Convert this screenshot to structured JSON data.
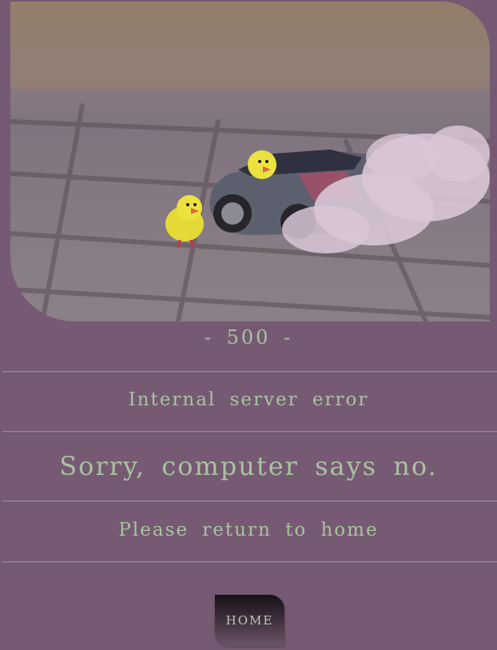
{
  "error": {
    "code_line": "- 500 -",
    "title": "Internal server error",
    "message": "Sorry, computer says no.",
    "instruction": "Please return to home"
  },
  "home_button": {
    "label": "HOME"
  },
  "hero_image": {
    "icon": "toy-car-with-chicks-photo"
  },
  "colors": {
    "background": "#765a73",
    "text": "#a9c3a0",
    "button_top": "#161016",
    "button_bottom": "#6a5468"
  }
}
